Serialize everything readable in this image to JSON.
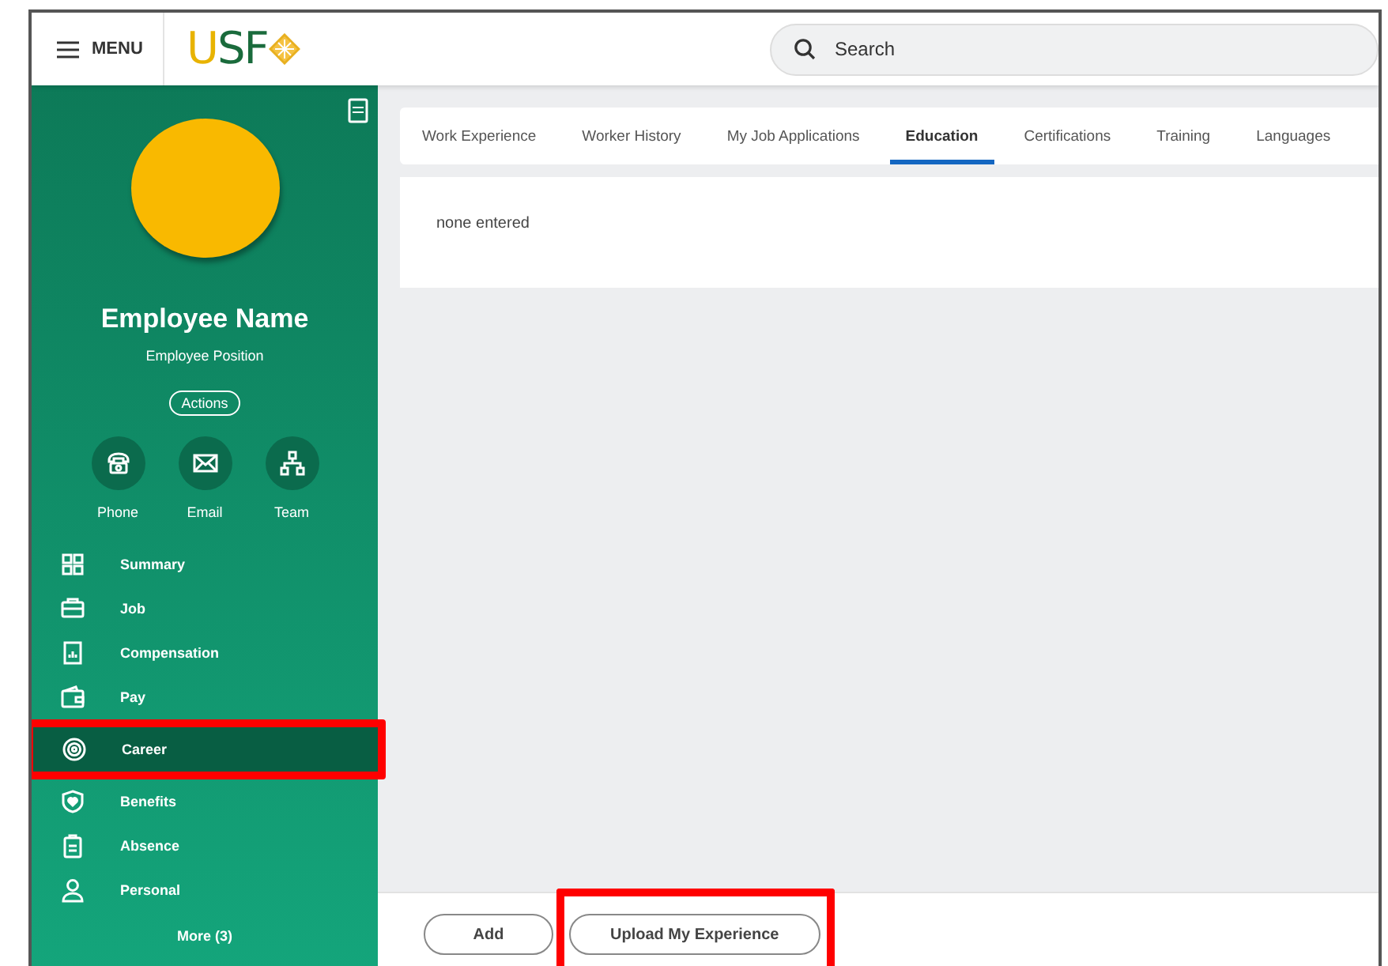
{
  "header": {
    "menu_label": "MENU",
    "logo_text": "USF",
    "search": {
      "placeholder": "Search"
    }
  },
  "profile": {
    "name": "Employee Name",
    "position": "Employee Position",
    "actions_label": "Actions",
    "quick_actions": [
      {
        "kind": "phone",
        "label": "Phone"
      },
      {
        "kind": "email",
        "label": "Email"
      },
      {
        "kind": "team",
        "label": "Team"
      }
    ]
  },
  "nav": {
    "items": [
      {
        "kind": "summary",
        "label": "Summary",
        "selected": false,
        "highlighted": false
      },
      {
        "kind": "job",
        "label": "Job",
        "selected": false,
        "highlighted": false
      },
      {
        "kind": "compensation",
        "label": "Compensation",
        "selected": false,
        "highlighted": false
      },
      {
        "kind": "pay",
        "label": "Pay",
        "selected": false,
        "highlighted": false
      },
      {
        "kind": "career",
        "label": "Career",
        "selected": true,
        "highlighted": true
      },
      {
        "kind": "benefits",
        "label": "Benefits",
        "selected": false,
        "highlighted": false
      },
      {
        "kind": "absence",
        "label": "Absence",
        "selected": false,
        "highlighted": false
      },
      {
        "kind": "personal",
        "label": "Personal",
        "selected": false,
        "highlighted": false
      }
    ],
    "more_label": "More (3)"
  },
  "tabs": [
    {
      "label": "Work Experience",
      "selected": false
    },
    {
      "label": "Worker History",
      "selected": false
    },
    {
      "label": "My Job Applications",
      "selected": false
    },
    {
      "label": "Education",
      "selected": true
    },
    {
      "label": "Certifications",
      "selected": false
    },
    {
      "label": "Training",
      "selected": false
    },
    {
      "label": "Languages",
      "selected": false
    }
  ],
  "content": {
    "empty_text": "none entered"
  },
  "buttons": [
    {
      "label": "Add",
      "highlighted": false
    },
    {
      "label": "Upload My Experience",
      "highlighted": true
    }
  ]
}
